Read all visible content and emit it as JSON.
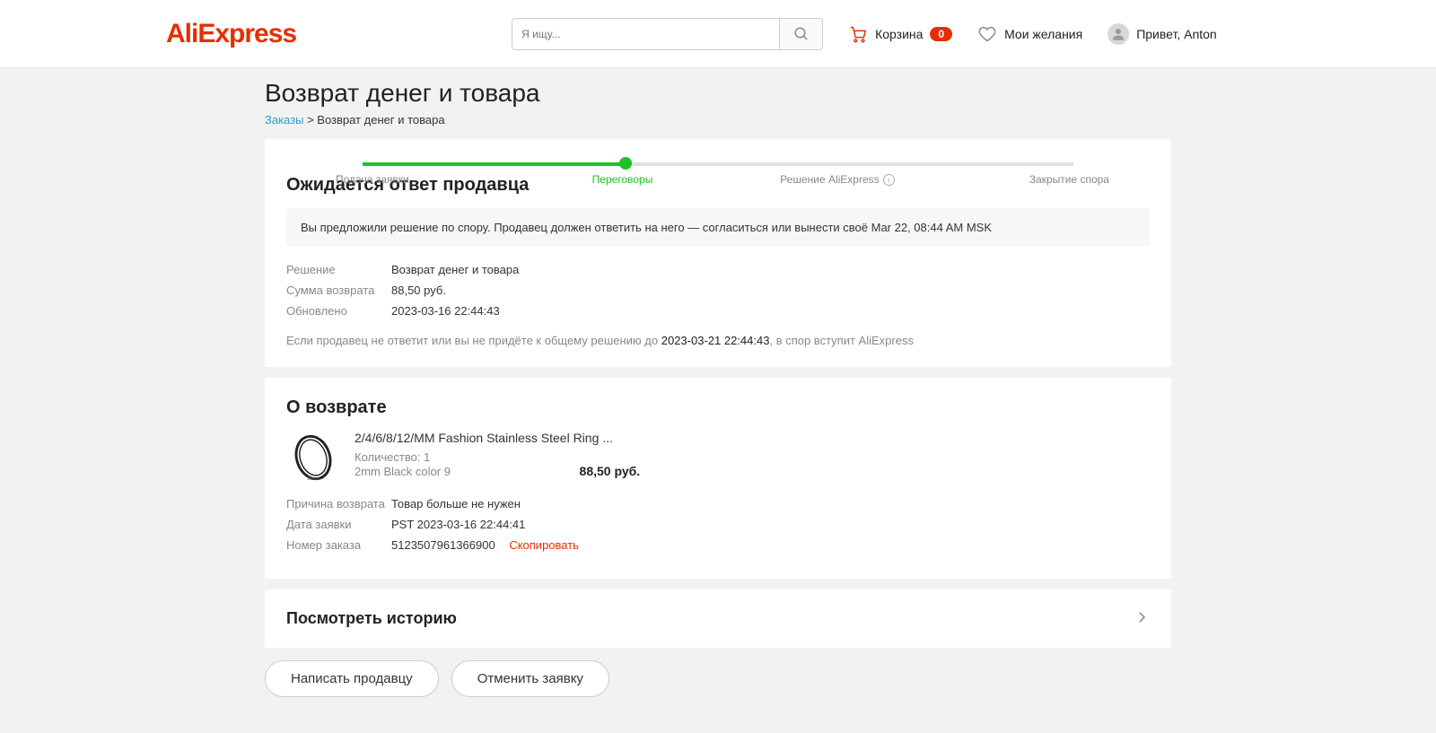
{
  "header": {
    "logo": "AliExpress",
    "search_placeholder": "Я ищу...",
    "cart_label": "Корзина",
    "cart_count": "0",
    "wishlist_label": "Мои желания",
    "greeting": "Привет, Anton"
  },
  "page": {
    "title": "Возврат денег и товара",
    "breadcrumb_orders": "Заказы",
    "breadcrumb_current": "Возврат денег и товара"
  },
  "steps": {
    "s1": "Подача заявки",
    "s2": "Переговоры",
    "s3": "Решение AliExpress",
    "s4": "Закрытие спора"
  },
  "status": {
    "heading": "Ожидается ответ продавца",
    "banner": "Вы предложили решение по спору. Продавец должен ответить на него — согласиться или вынести своё Mar 22, 08:44 AM MSK",
    "resolution_label": "Решение",
    "resolution_value": "Возврат денег и товара",
    "refund_label": "Сумма возврата",
    "refund_value": "88,50 руб.",
    "updated_label": "Обновлено",
    "updated_value": "2023-03-16 22:44:43",
    "note_pre": "Если продавец не ответит или вы не придёте к общему решению до ",
    "note_date": "2023-03-21 22:44:43",
    "note_post": ", в спор вступит AliExpress"
  },
  "about": {
    "heading": "О возврате",
    "product_title": "2/4/6/8/12/MM Fashion Stainless Steel Ring ...",
    "qty": "Количество: 1",
    "variant": "2mm Black color 9",
    "price": "88,50 руб.",
    "reason_label": "Причина возврата",
    "reason_value": "Товар больше не нужен",
    "date_label": "Дата заявки",
    "date_value": "PST 2023-03-16 22:44:41",
    "order_label": "Номер заказа",
    "order_value": "5123507961366900",
    "copy": "Скопировать"
  },
  "history": {
    "title": "Посмотреть историю"
  },
  "actions": {
    "contact": "Написать продавцу",
    "cancel": "Отменить заявку"
  }
}
